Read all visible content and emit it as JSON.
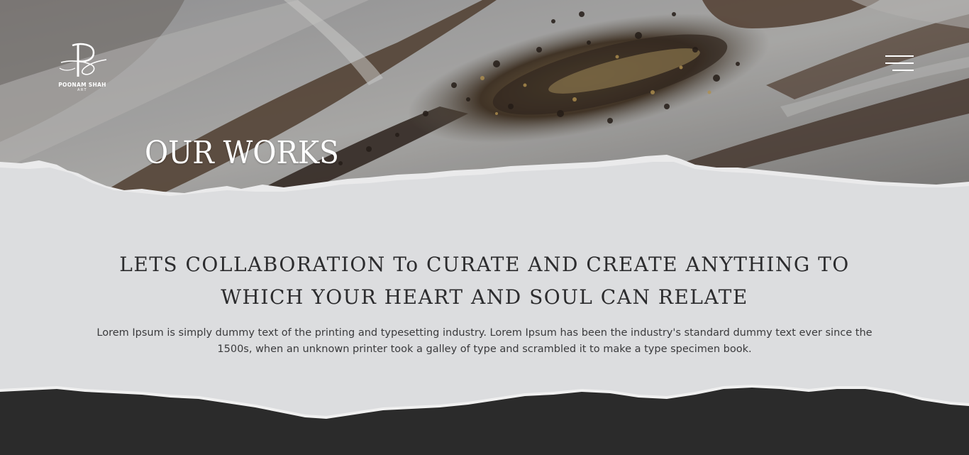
{
  "header": {
    "logo": {
      "monogram": "Ps",
      "name": "POONAM SHAH",
      "subtitle": "ART"
    },
    "menu_icon": "hamburger-menu-icon"
  },
  "hero": {
    "title": "OUR WORKS"
  },
  "intro": {
    "headline": "LETS COLLABORATION To CURATE AND CREATE ANYTHING TO WHICH YOUR HEART AND SOUL CAN RELATE",
    "body": "Lorem Ipsum is simply dummy text of the printing and typesetting industry. Lorem Ipsum has been the industry's standard dummy text ever since the 1500s, when an unknown printer took a galley of type and scrambled it to make a type specimen book."
  },
  "colors": {
    "page_background": "#dcdddf",
    "footer_background": "#2b2b2b",
    "text_dark": "#2c2c2e",
    "hero_text": "#ffffff"
  }
}
